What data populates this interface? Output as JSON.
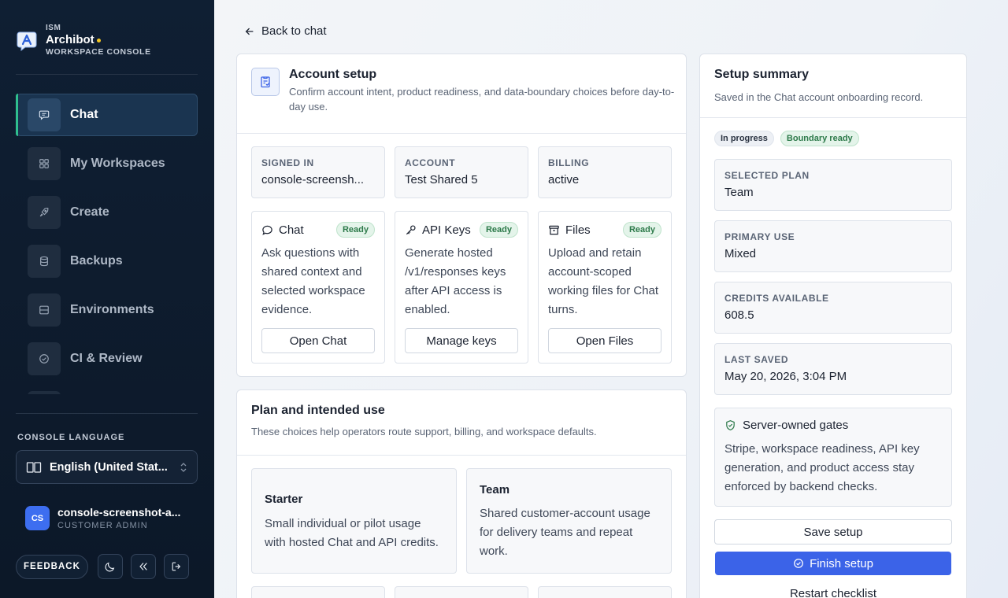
{
  "brand": {
    "org": "ISM",
    "name": "Archibot",
    "subtitle": "WORKSPACE CONSOLE"
  },
  "nav": [
    {
      "label": "Chat",
      "icon": "chat-icon",
      "active": true
    },
    {
      "label": "My Workspaces",
      "icon": "grid-icon"
    },
    {
      "label": "Create",
      "icon": "rocket-icon"
    },
    {
      "label": "Backups",
      "icon": "database-icon"
    },
    {
      "label": "Environments",
      "icon": "server-icon"
    },
    {
      "label": "CI & Review",
      "icon": "check-circle-icon"
    }
  ],
  "language": {
    "title": "CONSOLE LANGUAGE",
    "selected": "English (United Stat..."
  },
  "user": {
    "initials": "CS",
    "name": "console-screenshot-a...",
    "role": "CUSTOMER ADMIN"
  },
  "sidebar_actions": {
    "feedback": "FEEDBACK"
  },
  "back_label": "Back to chat",
  "account": {
    "title": "Account setup",
    "subtitle": "Confirm account intent, product readiness, and data-boundary choices before day-to-day use.",
    "facts": [
      {
        "label": "SIGNED IN",
        "value": "console-screensh..."
      },
      {
        "label": "ACCOUNT",
        "value": "Test Shared 5"
      },
      {
        "label": "BILLING",
        "value": "active"
      }
    ],
    "products": [
      {
        "name": "Chat",
        "icon": "chat-bubble-icon",
        "status": "Ready",
        "desc": "Ask questions with shared context and selected workspace evidence.",
        "button": "Open Chat"
      },
      {
        "name": "API Keys",
        "icon": "key-icon",
        "status": "Ready",
        "desc": "Generate hosted /v1/responses keys after API access is enabled.",
        "button": "Manage keys"
      },
      {
        "name": "Files",
        "icon": "archive-icon",
        "status": "Ready",
        "desc": "Upload and retain account-scoped working files for Chat turns.",
        "button": "Open Files"
      }
    ]
  },
  "plan": {
    "title": "Plan and intended use",
    "subtitle": "These choices help operators route support, billing, and workspace defaults.",
    "options": [
      {
        "name": "Starter",
        "desc": "Small individual or pilot usage with hosted Chat and API credits."
      },
      {
        "name": "Team",
        "desc": "Shared customer-account usage for delivery teams and repeat work."
      }
    ]
  },
  "summary": {
    "title": "Setup summary",
    "subtitle": "Saved in the Chat account onboarding record.",
    "badges": [
      "In progress",
      "Boundary ready"
    ],
    "items": [
      {
        "label": "SELECTED PLAN",
        "value": "Team"
      },
      {
        "label": "PRIMARY USE",
        "value": "Mixed"
      },
      {
        "label": "CREDITS AVAILABLE",
        "value": "608.5"
      },
      {
        "label": "LAST SAVED",
        "value": "May 20, 2026, 3:04 PM"
      }
    ],
    "gates": {
      "title": "Server-owned gates",
      "desc": "Stripe, workspace readiness, API key generation, and product access stay enforced by backend checks."
    },
    "save_label": "Save setup",
    "finish_label": "Finish setup",
    "restart_label": "Restart checklist"
  },
  "colors": {
    "accent": "#3b63e8",
    "active_indicator": "#2fbf8f",
    "ready": "#2d7a4a",
    "sidebar": "#0f1f33"
  }
}
